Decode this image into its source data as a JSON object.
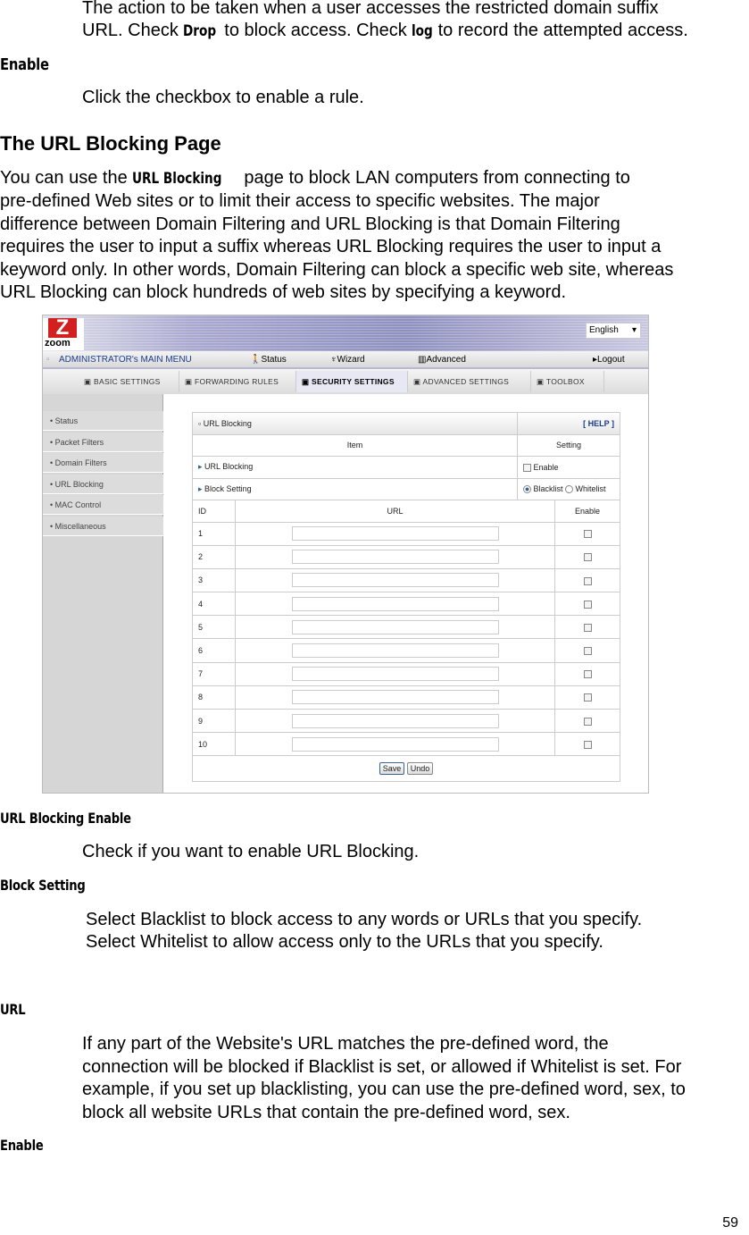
{
  "top": {
    "line1": "The action to be taken when a user accesses the restricted domain suffix",
    "line2_a": "URL. Check ",
    "line2_drop": "Drop",
    "line2_b": " to block access. Check ",
    "line2_log": "log",
    "line2_c": " to record the attempted access."
  },
  "enable1": {
    "heading": "Enable",
    "desc": "Click the checkbox to enable a rule."
  },
  "section": {
    "title": "The URL Blocking Page",
    "p_a": "You can use the ",
    "p_bold": "URL Blocking",
    "p_b": " page to block LAN computers from connecting to",
    "lines": [
      "pre-defined Web sites or to limit their access to specific websites. The major",
      "difference between Domain Filtering and URL Blocking is that Domain Filtering",
      "requires the user to input a suffix whereas URL Blocking requires the user to input a",
      "keyword only. In other words, Domain Filtering can block a specific web site, whereas",
      "URL Blocking can block hundreds of web sites by specifying a keyword."
    ]
  },
  "screenshot": {
    "logo": "zoom",
    "language": "English",
    "menu": {
      "main": "ADMINISTRATOR's MAIN MENU",
      "status": "Status",
      "wizard": "Wizard",
      "advanced": "Advanced",
      "logout": "Logout"
    },
    "tabs": [
      "BASIC SETTINGS",
      "FORWARDING RULES",
      "SECURITY SETTINGS",
      "ADVANCED SETTINGS",
      "TOOLBOX"
    ],
    "active_tab": "SECURITY SETTINGS",
    "sidebar": [
      "Status",
      "Packet Filters",
      "Domain Filters",
      "URL Blocking",
      "MAC Control",
      "Miscellaneous"
    ],
    "panel_title": "URL Blocking",
    "help": "[ HELP ]",
    "col_item": "Item",
    "col_setting": "Setting",
    "row_url_blocking": "URL Blocking",
    "enable_label": "Enable",
    "enable_checked": false,
    "row_block_setting": "Block Setting",
    "blacklist": "Blacklist",
    "whitelist": "Whitelist",
    "selected": "Blacklist",
    "col_id": "ID",
    "col_url": "URL",
    "col_enable": "Enable",
    "ids": [
      "1",
      "2",
      "3",
      "4",
      "5",
      "6",
      "7",
      "8",
      "9",
      "10"
    ],
    "save": "Save",
    "undo": "Undo"
  },
  "fields": {
    "url_enable": {
      "heading": "URL Blocking Enable",
      "desc": "Check if you want to enable URL Blocking."
    },
    "block_setting": {
      "heading": "Block Setting",
      "line1": "Select Blacklist to block access to any words or URLs that you specify.",
      "line2": "Select Whitelist to allow access only to the URLs that you specify."
    },
    "url": {
      "heading": "URL",
      "lines": [
        "If any part of the Website's URL matches the pre-defined word, the",
        "connection will be blocked if Blacklist is set, or allowed if Whitelist is set. For",
        "example, if you set up blacklisting, you can use the pre-defined word, sex, to",
        "block all website URLs that contain the pre-defined word, sex."
      ]
    },
    "enable2": {
      "heading": "Enable"
    }
  },
  "page_number": "59"
}
